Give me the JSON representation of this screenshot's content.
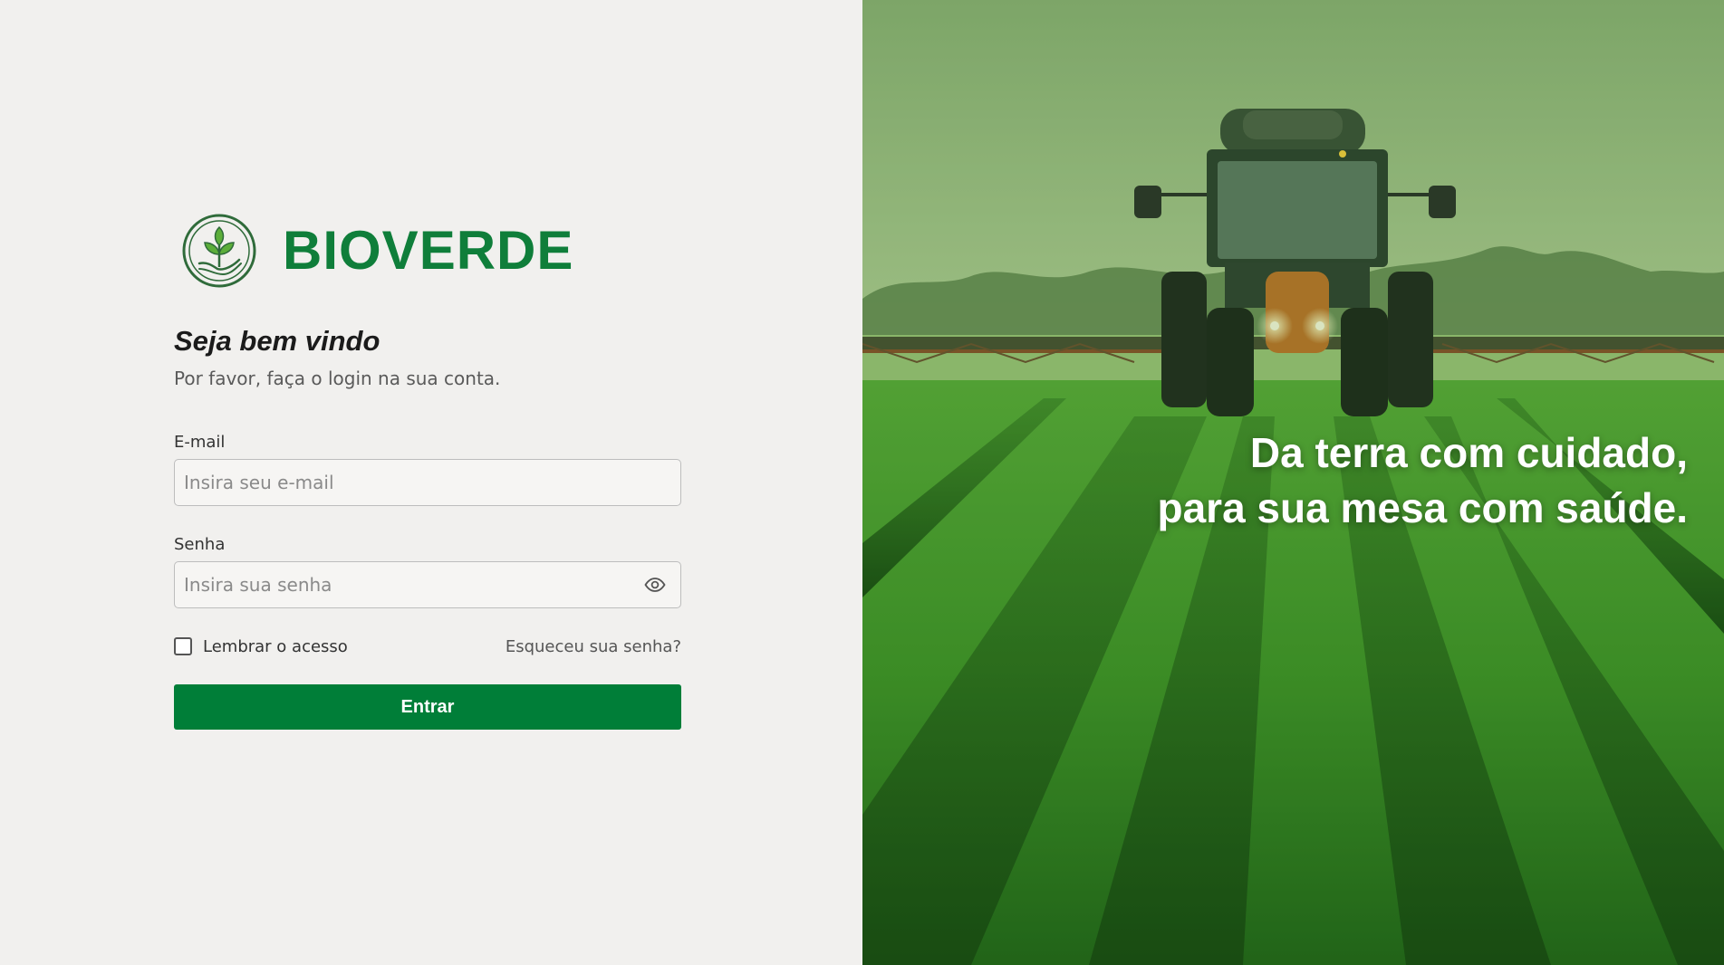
{
  "brand": {
    "name": "BIOVERDE",
    "logo_icon": "sprout-in-hand-icon",
    "color": "#0f7e3a"
  },
  "login": {
    "welcome": "Seja bem vindo",
    "subtitle": "Por favor, faça o login na sua conta.",
    "email_label": "E-mail",
    "email_placeholder": "Insira seu e-mail",
    "email_value": "",
    "password_label": "Senha",
    "password_placeholder": "Insira sua senha",
    "password_value": "",
    "password_toggle_icon": "eye-icon",
    "remember_label": "Lembrar o acesso",
    "remember_checked": false,
    "forgot_label": "Esqueceu sua senha?",
    "submit_label": "Entrar",
    "submit_color": "#007e38"
  },
  "hero": {
    "tagline_line1": "Da terra com cuidado,",
    "tagline_line2": "para sua mesa com saúde.",
    "image_subject": "tractor-spraying-crop-field"
  }
}
